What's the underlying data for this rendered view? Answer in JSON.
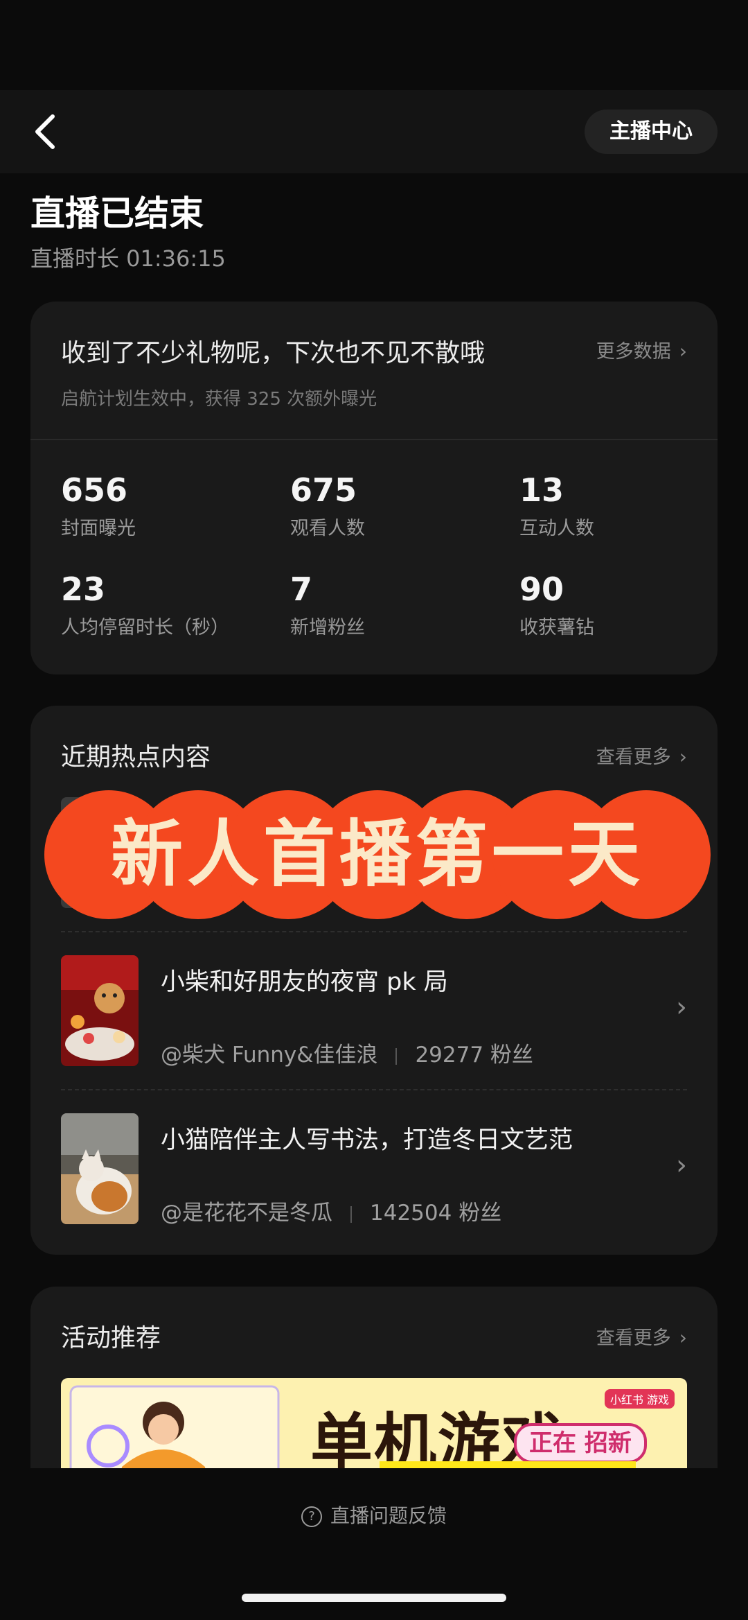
{
  "header": {
    "host_center": "主播中心"
  },
  "summary": {
    "title": "直播已结束",
    "duration": "直播时长 01:36:15"
  },
  "gift_card": {
    "headline": "收到了不少礼物呢，下次也不见不散哦",
    "more_label": "更多数据",
    "sub": "启航计划生效中，获得 325 次额外曝光",
    "stats": [
      {
        "value": "656",
        "label": "封面曝光"
      },
      {
        "value": "675",
        "label": "观看人数"
      },
      {
        "value": "13",
        "label": "互动人数"
      },
      {
        "value": "23",
        "label": "人均停留时长（秒）"
      },
      {
        "value": "7",
        "label": "新增粉丝"
      },
      {
        "value": "90",
        "label": "收获薯钻"
      }
    ]
  },
  "hot": {
    "title": "近期热点内容",
    "more_label": "查看更多",
    "overlay_text": "新人首播第一天",
    "items": [
      {
        "title": "小柴和好朋友的夜宵 pk 局",
        "author": "@柴犬 Funny&佳佳浪",
        "fans": "29277 粉丝"
      },
      {
        "title": "小猫陪伴主人写书法，打造冬日文艺范",
        "author": "@是花花不是冬瓜",
        "fans": "142504 粉丝"
      }
    ]
  },
  "activity": {
    "title": "活动推荐",
    "more_label": "查看更多",
    "banner_title": "单机游戏",
    "banner_tag": "正在 招新",
    "banner_brand": "小红书 游戏"
  },
  "footer": {
    "feedback": "直播问题反馈"
  },
  "colors": {
    "overlay_fill": "#f4481f",
    "overlay_text": "#fbe9c8",
    "banner_bg": "#fdf1b0"
  }
}
